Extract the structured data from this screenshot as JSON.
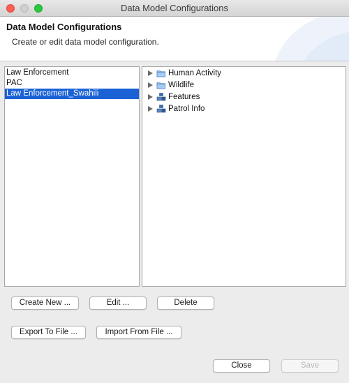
{
  "window": {
    "title": "Data Model Configurations"
  },
  "header": {
    "title": "Data Model Configurations",
    "subtitle": "Create or edit data model configuration."
  },
  "configurations": [
    {
      "label": "Law Enforcement",
      "selected": false
    },
    {
      "label": "PAC",
      "selected": false
    },
    {
      "label": "Law Enforcement_Swahili",
      "selected": true
    }
  ],
  "tree": [
    {
      "label": "Human Activity",
      "icon": "folder-icon"
    },
    {
      "label": "Wildlife",
      "icon": "folder-icon"
    },
    {
      "label": "Features",
      "icon": "blocks-icon"
    },
    {
      "label": "Patrol Info",
      "icon": "blocks-icon"
    }
  ],
  "buttons": {
    "create_new": "Create New ...",
    "edit": "Edit ...",
    "delete": "Delete",
    "export": "Export To File ...",
    "import": "Import From File ...",
    "close": "Close",
    "save": "Save"
  },
  "colors": {
    "selection": "#1a62d6",
    "close_traffic": "#ff5f57",
    "max_traffic": "#28c940"
  }
}
